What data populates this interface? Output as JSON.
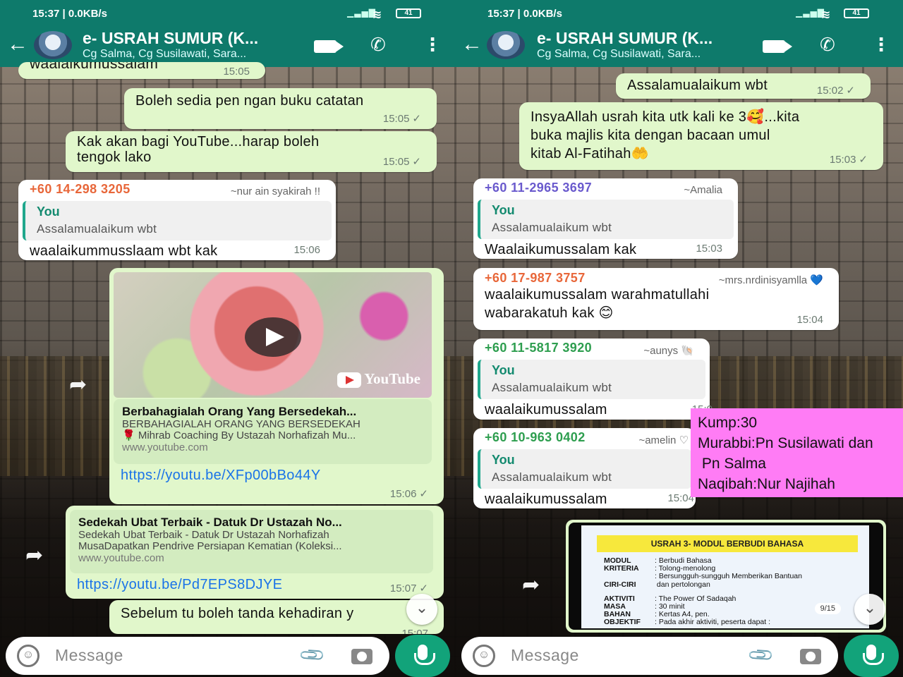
{
  "left": {
    "status": {
      "time": "15:37 | 0.0KB/s",
      "battery": "41"
    },
    "header": {
      "title": "e- USRAH SUMUR (K...",
      "subtitle": "Cg Salma, Cg Susilawati, Sara..."
    },
    "messages": {
      "m0": {
        "text": "waalaikumussalam",
        "time": "15:05"
      },
      "m1": {
        "text": "Boleh sedia pen ngan buku catatan",
        "time": "15:05"
      },
      "m2": {
        "text": "Kak akan bagi YouTube...harap boleh\ntengok lako",
        "time": "15:05"
      },
      "m3": {
        "sender": "+60 14-298 3205",
        "alias": "~nur ain syakirah !!",
        "quote_author": "You",
        "quote_text": "Assalamualaikum wbt",
        "text": "waalaikummusslaam wbt kak",
        "time": "15:06"
      },
      "m4": {
        "yt_label": "YouTube",
        "link_title": "Berbahagialah Orang Yang Bersedekah...",
        "link_desc": "BERBAHAGIALAH ORANG YANG BERSEDEKAH\n🌹 Mihrab Coaching By Ustazah Norhafizah Mu...",
        "link_domain": "www.youtube.com",
        "url": "https://youtu.be/XFp00bBo44Y",
        "time": "15:06"
      },
      "m5": {
        "link_title": "Sedekah Ubat Terbaik - Datuk Dr Ustazah No...",
        "link_desc": "Sedekah Ubat Terbaik - Datuk Dr Ustazah Norhafizah\nMusaDapatkan Pendrive Persiapan Kematian (Koleksi...",
        "link_domain": "www.youtube.com",
        "url": "https://youtu.be/Pd7EPS8DJYE",
        "time": "15:07"
      },
      "m6": {
        "text": "Sebelum tu boleh tanda kehadiran y",
        "time": "15:07"
      }
    },
    "input": {
      "placeholder": "Message"
    }
  },
  "right": {
    "status": {
      "time": "15:37 | 0.0KB/s",
      "battery": "41"
    },
    "header": {
      "title": "e- USRAH SUMUR (K...",
      "subtitle": "Cg Salma, Cg Susilawati, Sara..."
    },
    "messages": {
      "m1": {
        "text": "Assalamualaikum wbt",
        "time": "15:02"
      },
      "m2": {
        "text": "InsyaAllah usrah kita utk kali ke 3🥰...kita\nbuka majlis kita dengan bacaan umul\nkitab Al-Fatihah🤲",
        "time": "15:03"
      },
      "m3": {
        "sender": "+60 11-2965 3697",
        "alias": "~Amalia",
        "quote_author": "You",
        "quote_text": "Assalamualaikum wbt",
        "text": "Waalaikumussalam kak",
        "time": "15:03"
      },
      "m4": {
        "sender": "+60 17-987 3757",
        "alias": "~mrs.nrdinisyamlla 💙",
        "text": "waalaikumussalam warahmatullahi\nwabarakatuh kak 😊",
        "time": "15:04"
      },
      "m5": {
        "sender": "+60 11-5817 3920",
        "alias": "~aunys 🐚",
        "quote_author": "You",
        "quote_text": "Assalamualaikum wbt",
        "text": "waalaikumussalam",
        "time": "15:0"
      },
      "m6": {
        "sender": "+60 10-963 0402",
        "alias": "~amelin ♡",
        "quote_author": "You",
        "quote_text": "Assalamualaikum wbt",
        "text": "waalaikumussalam",
        "time": "15:04"
      },
      "m7": {
        "slide_title": "USRAH 3- MODUL BERBUDI BAHASA",
        "rows": [
          {
            "k": "MODUL",
            "v": ": Berbudi Bahasa"
          },
          {
            "k": "KRITERIA",
            "v": ": Tolong-menolong"
          },
          {
            "k": "",
            "v": ": Bersungguh-sungguh  Memberikan  Bantuan"
          },
          {
            "k": "CIRI-CIRI",
            "v": "  dan pertolongan"
          },
          {
            "k": "AKTIVITI",
            "v": ": The Power Of Sadaqah"
          },
          {
            "k": "MASA",
            "v": ": 30 minit"
          },
          {
            "k": "BAHAN",
            "v": ": Kertas A4, pen."
          },
          {
            "k": "OBJEKTIF",
            "v": ": Pada akhir aktiviti, peserta dapat :"
          }
        ],
        "page": "9/15"
      }
    },
    "input": {
      "placeholder": "Message"
    }
  },
  "note": {
    "text": "Kump:30\nMurabbi:Pn Susilawati dan\n Pn Salma\nNaqibah:Nur Najihah"
  },
  "colors": {
    "header": "#0e7a6b",
    "outgoing": "#e1f7cb",
    "incoming": "#ffffff",
    "note": "#ff7cf5"
  }
}
